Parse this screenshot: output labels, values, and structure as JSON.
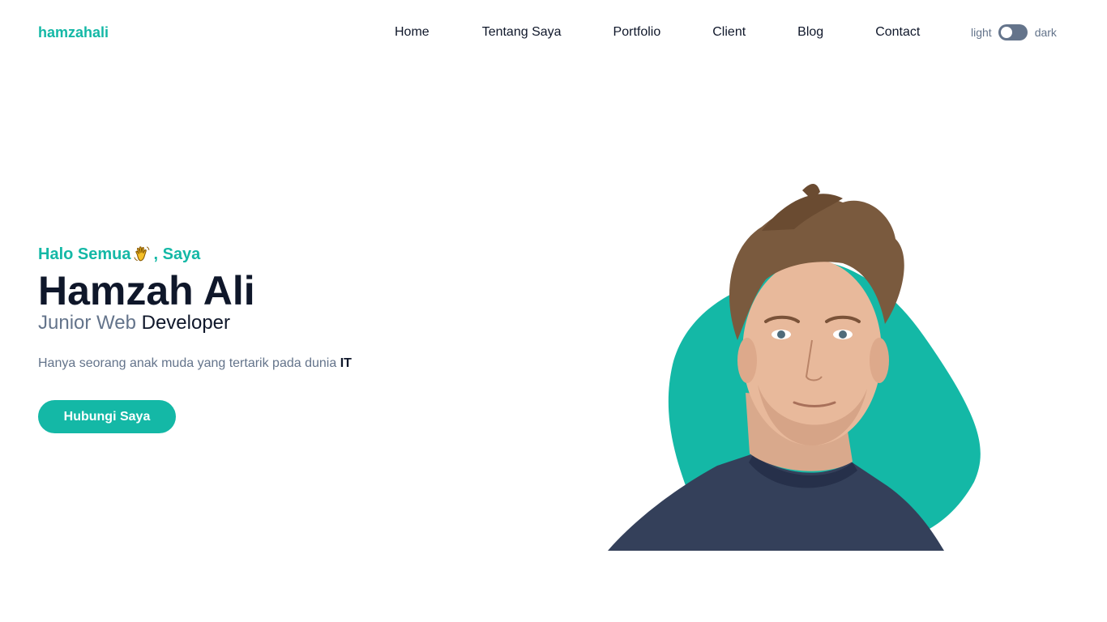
{
  "header": {
    "brand": "hamzahali",
    "nav": [
      "Home",
      "Tentang Saya",
      "Portfolio",
      "Client",
      "Blog",
      "Contact"
    ],
    "theme": {
      "light_label": "light",
      "dark_label": "dark"
    }
  },
  "hero": {
    "greeting_prefix": "Halo Semua",
    "greeting_suffix": ", Saya",
    "name": "Hamzah Ali",
    "role_muted": "Junior Web",
    "role_strong": "Developer",
    "tagline": "Hanya seorang anak muda yang tertarik pada dunia",
    "tagline_bold": "IT",
    "cta_label": "Hubungi Saya"
  },
  "colors": {
    "accent": "#14b8a6",
    "text": "#0f172a",
    "muted": "#64748b"
  },
  "icons": {
    "wave": "waving-hand-icon",
    "portrait": "person-portrait"
  }
}
